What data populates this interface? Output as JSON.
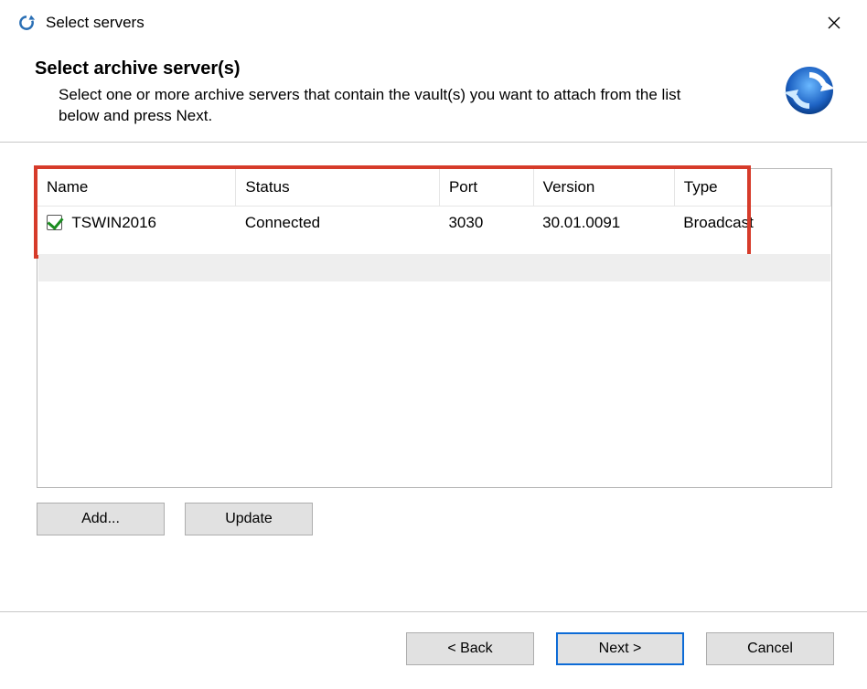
{
  "window": {
    "title": "Select servers"
  },
  "header": {
    "title": "Select archive server(s)",
    "description": "Select one or more archive servers that contain the vault(s) you want to attach from the list below and press Next."
  },
  "table": {
    "columns": {
      "name": "Name",
      "status": "Status",
      "port": "Port",
      "version": "Version",
      "type": "Type"
    },
    "rows": [
      {
        "checked": true,
        "name": "TSWIN2016",
        "status": "Connected",
        "port": "3030",
        "version": "30.01.0091",
        "type": "Broadcast"
      }
    ]
  },
  "buttons": {
    "add": "Add...",
    "update": "Update",
    "back": "< Back",
    "next": "Next >",
    "cancel": "Cancel"
  }
}
